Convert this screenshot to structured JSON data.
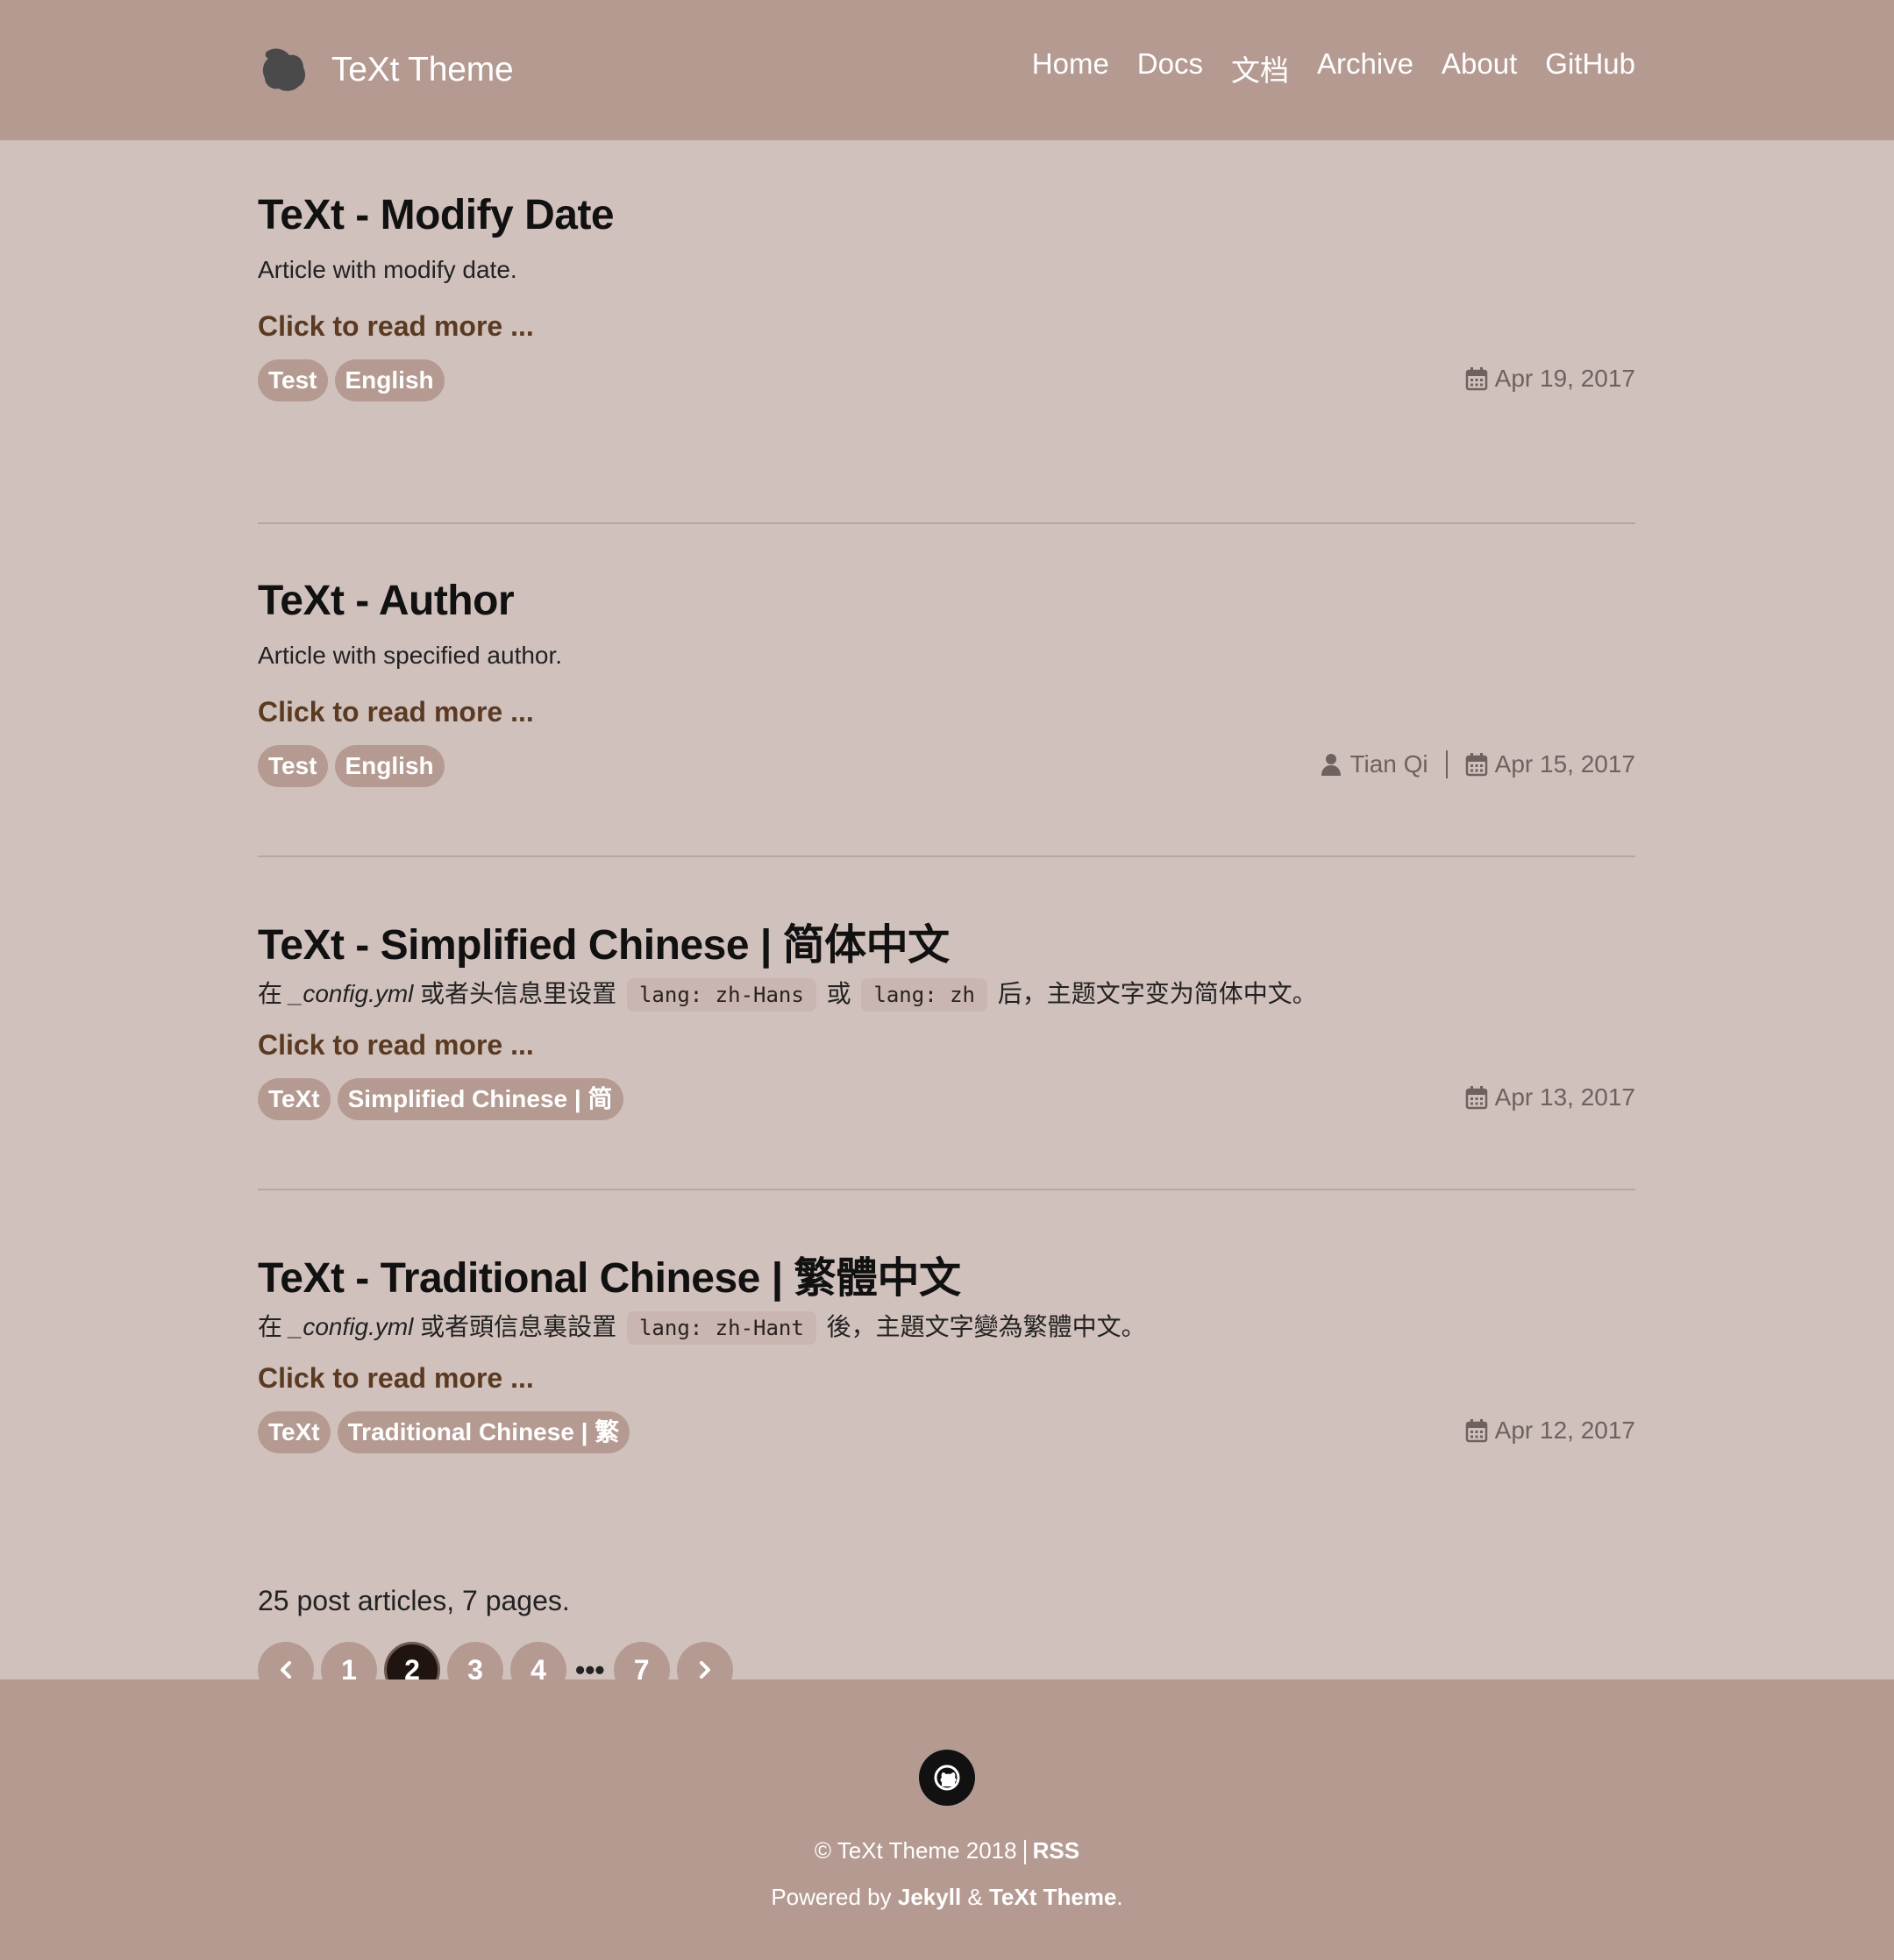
{
  "header": {
    "brand": "TeXt Theme",
    "nav": [
      "Home",
      "Docs",
      "文档",
      "Archive",
      "About",
      "GitHub"
    ]
  },
  "articles": [
    {
      "title": "TeXt - Modify Date",
      "excerpt_text": "Article with modify date.",
      "more": "Click to read more ...",
      "tags": [
        "Test",
        "English"
      ],
      "author": "",
      "date": "Apr 19, 2017"
    },
    {
      "title": "TeXt - Author",
      "excerpt_text": "Article with specified author.",
      "more": "Click to read more ...",
      "tags": [
        "Test",
        "English"
      ],
      "author": "Tian Qi",
      "date": "Apr 15, 2017"
    },
    {
      "title": "TeXt - Simplified Chinese | 简体中文",
      "excerpt_pre": "在 ",
      "excerpt_em": "_config.yml",
      "excerpt_mid": " 或者头信息里设置",
      "code1": "lang: zh-Hans",
      "excerpt_or": "或",
      "code2": "lang: zh",
      "excerpt_post": "后，主题文字变为简体中文。",
      "more": "Click to read more ...",
      "tags": [
        "TeXt",
        "Simplified Chinese | 简"
      ],
      "date": "Apr 13, 2017"
    },
    {
      "title": "TeXt - Traditional Chinese | 繁體中文",
      "excerpt_pre": "在 ",
      "excerpt_em": "_config.yml",
      "excerpt_mid": " 或者頭信息裏設置",
      "code1": "lang: zh-Hant",
      "excerpt_post": "後，主題文字變為繁體中文。",
      "more": "Click to read more ...",
      "tags": [
        "TeXt",
        "Traditional Chinese | 繁"
      ],
      "date": "Apr 12, 2017"
    }
  ],
  "pagination": {
    "info": "25 post articles, 7 pages.",
    "pages": [
      "1",
      "2",
      "3",
      "4",
      "7"
    ],
    "ellipsis": "•••",
    "current": "2"
  },
  "footer": {
    "copyright": "© TeXt Theme 2018",
    "rss": "RSS",
    "powered_pre": "Powered by ",
    "jekyll": "Jekyll",
    "amp": " & ",
    "theme": "TeXt Theme",
    "period": "."
  },
  "icons": {
    "brand": "text-logo-icon",
    "calendar": "calendar-icon",
    "user": "user-icon",
    "github": "github-icon",
    "prev": "chevron-left-icon",
    "next": "chevron-right-icon"
  },
  "colors": {
    "header_bg": "#b59a92",
    "page_bg": "#d1c1bc",
    "accent_link": "#5a3a22",
    "active_page": "#1f1410"
  }
}
